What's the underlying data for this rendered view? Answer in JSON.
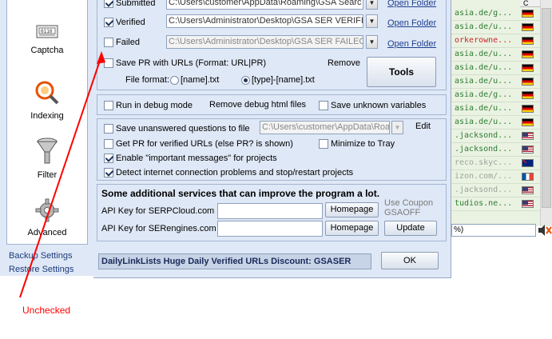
{
  "sidebar": {
    "items": [
      {
        "label": "Captcha",
        "icon": "captcha-icon"
      },
      {
        "label": "Indexing",
        "icon": "indexing-icon"
      },
      {
        "label": "Filter",
        "icon": "filter-icon"
      },
      {
        "label": "Advanced",
        "icon": "gear-icon"
      }
    ],
    "backup_label": "Backup Settings",
    "restore_label": "Restore Settings"
  },
  "files": {
    "submitted_label": "Submitted",
    "submitted_path": "C:\\Users\\customer\\AppData\\Roaming\\GSA Searc",
    "verified_label": "Verified",
    "verified_path": "C:\\Users\\Administrator\\Desktop\\GSA SER VERIFI",
    "failed_label": "Failed",
    "failed_path": "C:\\Users\\Administrator\\Desktop\\GSA SER FAILEC",
    "open_folder_label": "Open Folder",
    "save_pr_label": "Save PR with URLs (Format: URL|PR)",
    "remove_label": "Remove",
    "tools_label": "Tools",
    "file_format_label": "File format:",
    "format_option_1": "[name].txt",
    "format_option_2": "[type]-[name].txt"
  },
  "debug": {
    "debug_mode_label": "Run in debug mode",
    "remove_debug_label": "Remove debug html files",
    "save_unknown_label": "Save unknown variables"
  },
  "options": {
    "save_unanswered_label": "Save unanswered questions to file",
    "unanswered_path": "C:\\Users\\customer\\AppData\\Roa",
    "edit_label": "Edit",
    "get_pr_label": "Get PR for verified URLs (else PR? is shown)",
    "minimize_tray_label": "Minimize to Tray",
    "important_msgs_label": "Enable \"important messages\" for projects",
    "detect_internet_label": "Detect internet connection problems and stop/restart projects"
  },
  "services": {
    "heading": "Some additional services that can improve the program a lot.",
    "serpcloud_label": "API Key for SERPCloud.com",
    "serengines_label": "API Key for SERengines.com",
    "homepage_label": "Homepage",
    "update_label": "Update",
    "coupon_text": "Use Coupon GSAOFF"
  },
  "footer": {
    "discount_text": "DailyLinkLists Huge Daily Verified URLs Discount: GSASER",
    "ok_label": "OK"
  },
  "background_list": {
    "header": "C",
    "rows": [
      {
        "text": "asia.de/g...",
        "flag": "de",
        "color": "#2e7d32"
      },
      {
        "text": "asia.de/u...",
        "flag": "de",
        "color": "#2e7d32"
      },
      {
        "text": "orkerowne...",
        "flag": "de",
        "color": "#c62828"
      },
      {
        "text": "asia.de/u...",
        "flag": "de",
        "color": "#2e7d32"
      },
      {
        "text": "asia.de/u...",
        "flag": "de",
        "color": "#2e7d32"
      },
      {
        "text": "asia.de/u...",
        "flag": "de",
        "color": "#2e7d32"
      },
      {
        "text": "asia.de/g...",
        "flag": "de",
        "color": "#2e7d32"
      },
      {
        "text": "asia.de/u...",
        "flag": "de",
        "color": "#2e7d32"
      },
      {
        "text": "asia.de/u...",
        "flag": "de",
        "color": "#2e7d32"
      },
      {
        "text": ".jacksond...",
        "flag": "us",
        "color": "#2e7d32"
      },
      {
        "text": ".jacksond...",
        "flag": "us",
        "color": "#2e7d32"
      },
      {
        "text": "reco.skyc...",
        "flag": "au",
        "color": "#9aa69a"
      },
      {
        "text": "izon.com/...",
        "flag": "fr",
        "color": "#9aa69a"
      },
      {
        "text": ".jacksond...",
        "flag": "us",
        "color": "#9aa69a"
      },
      {
        "text": "tudios.ne...",
        "flag": "us",
        "color": "#2e7d32"
      }
    ],
    "percent_text": "%)"
  },
  "annotation": {
    "text": "Unchecked",
    "color": "#ff0000"
  }
}
